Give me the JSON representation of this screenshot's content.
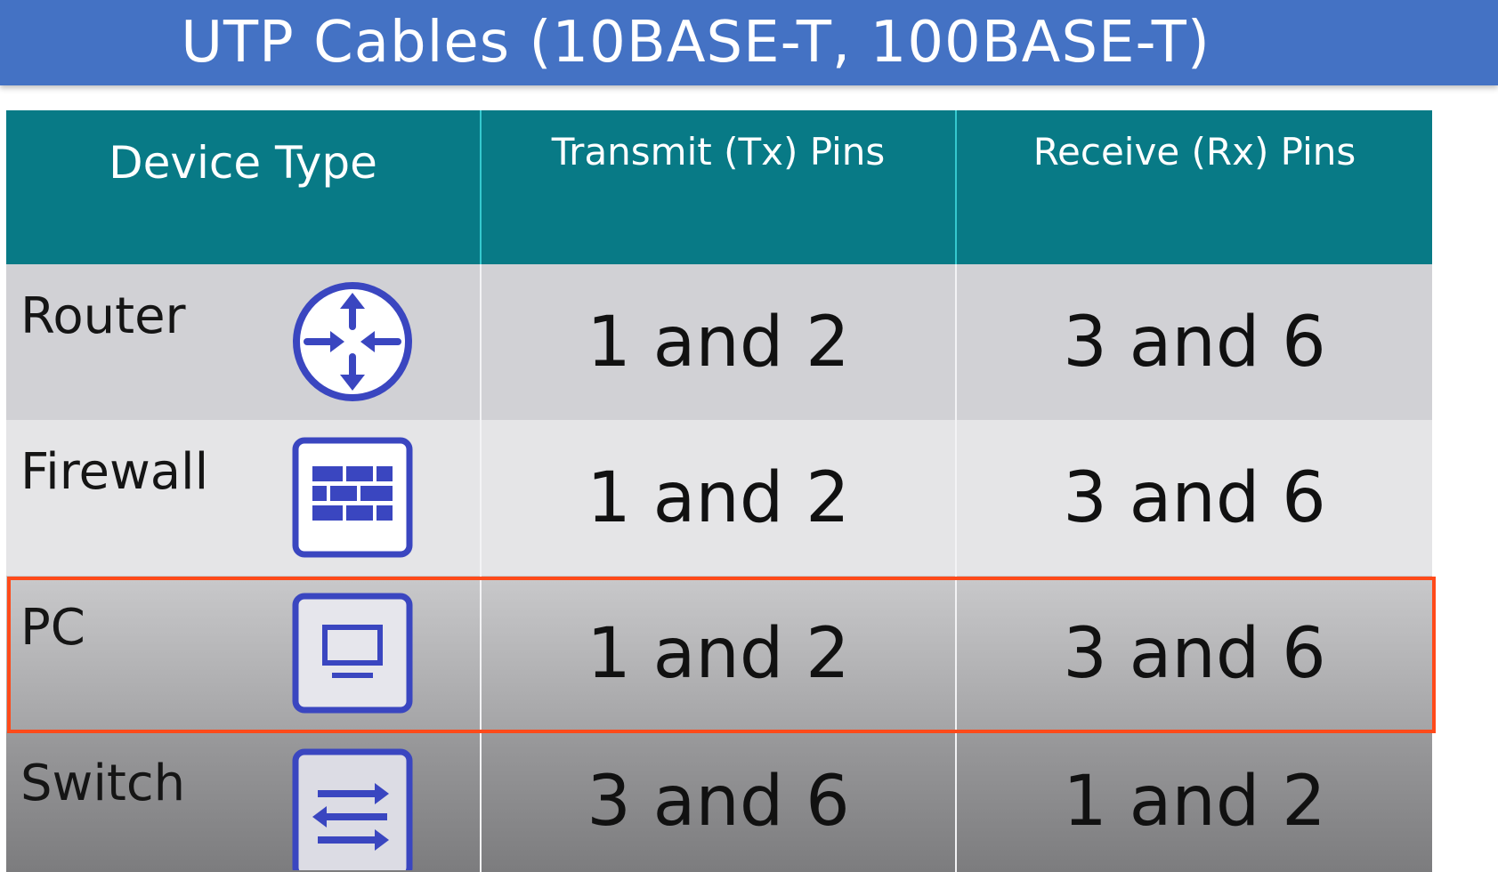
{
  "title": "UTP Cables (10BASE-T, 100BASE-T)",
  "colors": {
    "title_bar": "#4472c4",
    "header": "#087a86",
    "icon": "#3a46c0",
    "highlight": "#ff4a1a"
  },
  "table": {
    "headers": [
      "Device Type",
      "Transmit (Tx) Pins",
      "Receive (Rx) Pins"
    ],
    "rows": [
      {
        "device": "Router",
        "icon": "router-icon",
        "tx": "1 and 2",
        "rx": "3 and 6"
      },
      {
        "device": "Firewall",
        "icon": "firewall-icon",
        "tx": "1 and 2",
        "rx": "3 and 6"
      },
      {
        "device": "PC",
        "icon": "pc-icon",
        "tx": "1 and 2",
        "rx": "3 and 6",
        "highlighted": true
      },
      {
        "device": "Switch",
        "icon": "switch-icon",
        "tx": "3 and 6",
        "rx": "1 and 2"
      }
    ]
  }
}
